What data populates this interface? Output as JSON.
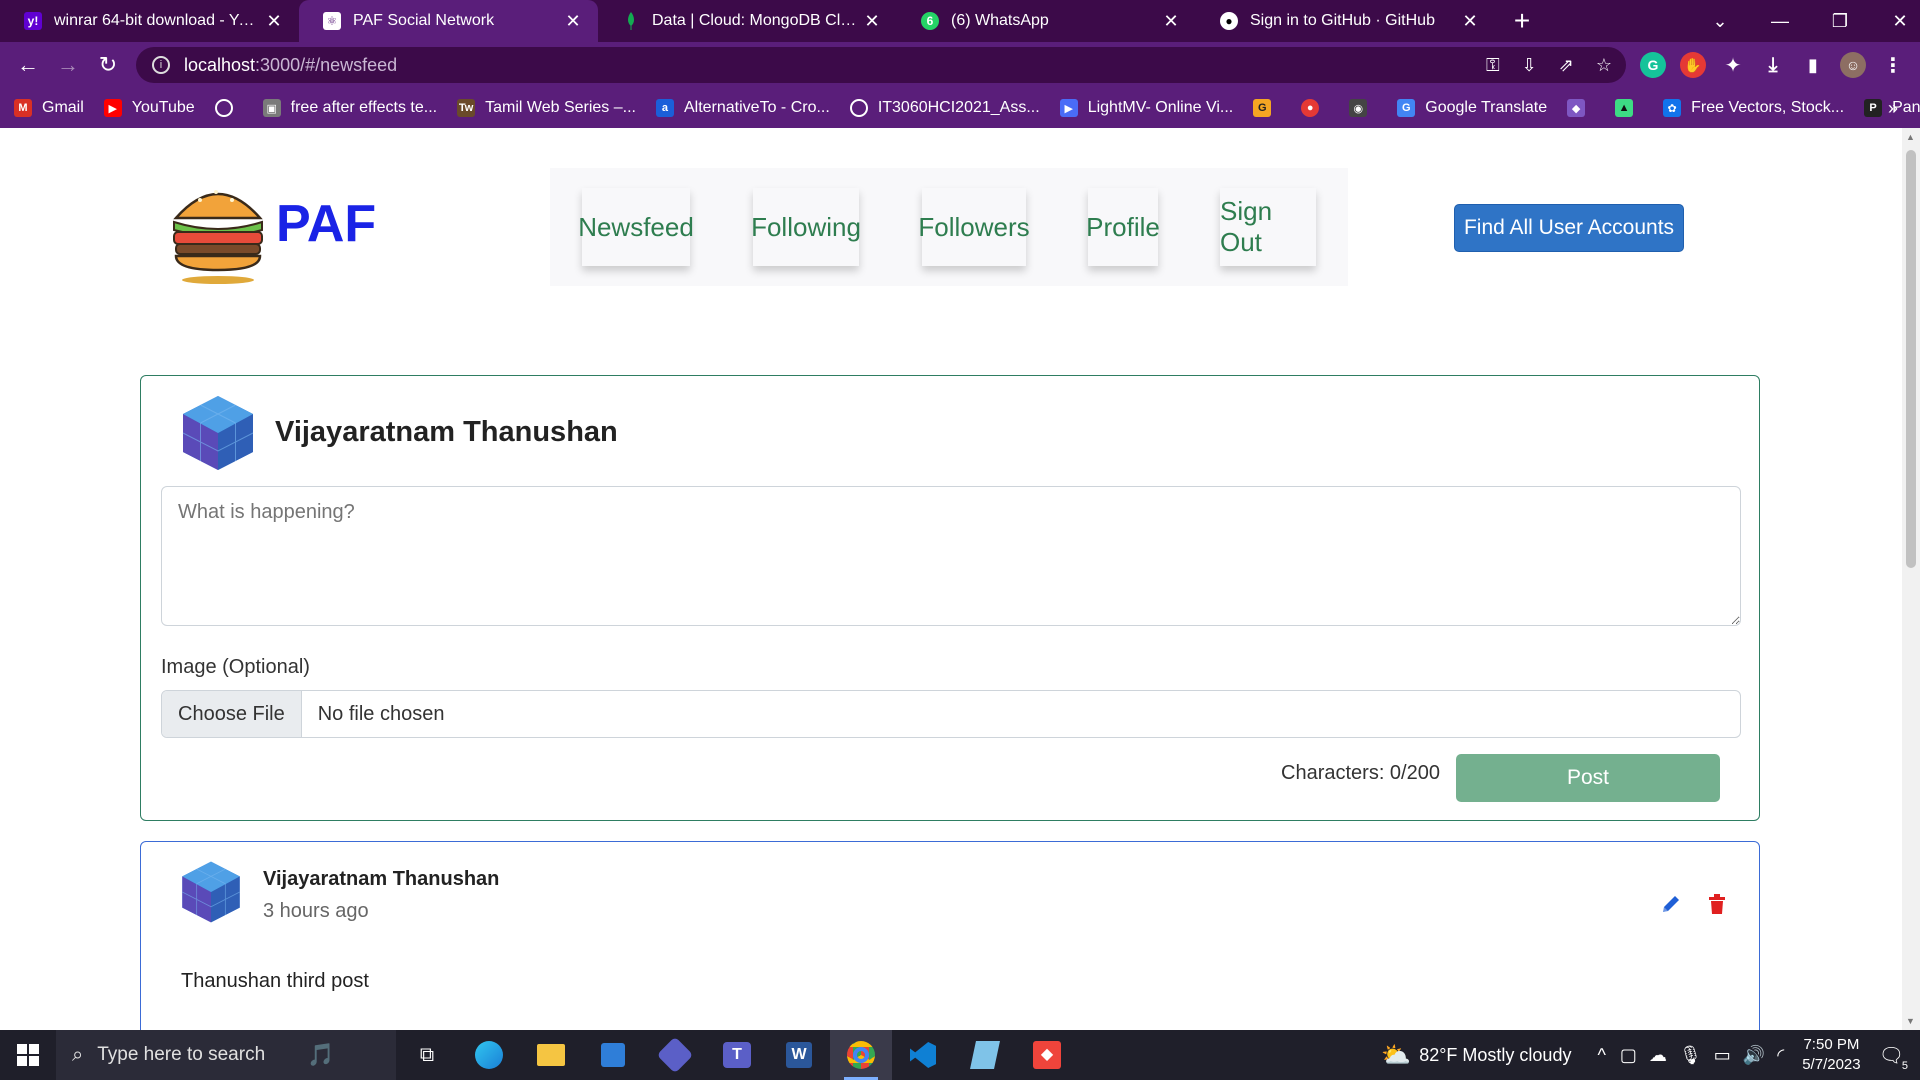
{
  "browser": {
    "tabs": [
      {
        "title": "winrar 64-bit download - Yahoo Search",
        "favicon": "yahoo-icon",
        "color": "#6001d2"
      },
      {
        "title": "PAF Social Network",
        "favicon": "react-icon",
        "color": "#ffffff"
      },
      {
        "title": "Data | Cloud: MongoDB Cloud",
        "favicon": "mongodb-leaf-icon",
        "color": "#13aa52"
      },
      {
        "title": "(6) WhatsApp",
        "favicon": "whatsapp-icon",
        "color": "#25d366"
      },
      {
        "title": "Sign in to GitHub · GitHub",
        "favicon": "github-icon",
        "color": "#ffffff"
      }
    ],
    "address": {
      "host": "localhost",
      "path": ":3000/#/newsfeed"
    },
    "bookmarks": [
      {
        "label": "Gmail",
        "icon": "gmail-icon",
        "color": "#d93025"
      },
      {
        "label": "YouTube",
        "icon": "youtube-icon",
        "color": "#ff0000"
      },
      {
        "label": "",
        "icon": "globe-icon",
        "color": "#8a8a8a"
      },
      {
        "label": "free after effects te...",
        "icon": "image-icon",
        "color": "#7a7a7a"
      },
      {
        "label": "Tamil Web Series –...",
        "icon": "tw-icon",
        "color": "#6a4a2a"
      },
      {
        "label": "AlternativeTo - Cro...",
        "icon": "alternativeto-icon",
        "color": "#1b5fd9"
      },
      {
        "label": "IT3060HCI2021_Ass...",
        "icon": "globe-icon",
        "color": "#8a8a8a"
      },
      {
        "label": "LightMV- Online Vi...",
        "icon": "play-icon",
        "color": "#4a6cf7"
      },
      {
        "label": "",
        "icon": "g-icon",
        "color": "#f5a623"
      },
      {
        "label": "",
        "icon": "record-icon",
        "color": "#e53935"
      },
      {
        "label": "",
        "icon": "camera-icon",
        "color": "#444444"
      },
      {
        "label": "Google Translate",
        "icon": "translate-icon",
        "color": "#4285f4"
      },
      {
        "label": "",
        "icon": "app-icon",
        "color": "#7e57c2"
      },
      {
        "label": "",
        "icon": "android-icon",
        "color": "#3ddc84"
      },
      {
        "label": "Free Vectors, Stock...",
        "icon": "freepik-icon",
        "color": "#1273eb"
      },
      {
        "label": "Panzoid",
        "icon": "panzoid-icon",
        "color": "#222222"
      }
    ]
  },
  "app": {
    "brand": "PAF",
    "nav": [
      "Newsfeed",
      "Following",
      "Followers",
      "Profile",
      "Sign Out"
    ],
    "find_button": "Find All User Accounts"
  },
  "composer": {
    "user_name": "Vijayaratnam Thanushan",
    "placeholder": "What is happening?",
    "image_label": "Image (Optional)",
    "choose_file": "Choose File",
    "no_file": "No file chosen",
    "char_count": "Characters: 0/200",
    "post_button": "Post"
  },
  "feed": [
    {
      "author": "Vijayaratnam Thanushan",
      "time": "3 hours ago",
      "text": "Thanushan third post"
    }
  ],
  "taskbar": {
    "search_placeholder": "Type here to search",
    "weather": "82°F  Mostly cloudy",
    "time": "7:50 PM",
    "date": "5/7/2023",
    "notifications": "5"
  },
  "colors": {
    "brand": "#1a23e6",
    "nav_text": "#2e7d4f",
    "find_button": "#2f74c6",
    "post_button": "#74b08f",
    "composer_border": "#2e7d62",
    "post_border": "#3b6bd6",
    "edit_icon": "#1f5fd6",
    "delete_icon": "#e02020"
  }
}
